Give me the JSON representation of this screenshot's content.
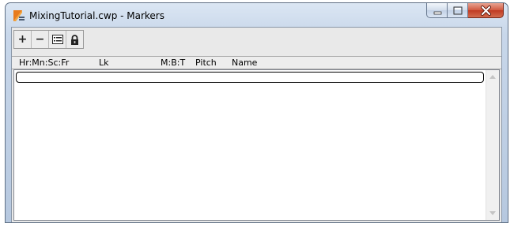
{
  "window": {
    "title": "MixingTutorial.cwp - Markers"
  },
  "toolbar": {
    "buttons": [
      {
        "label": "+",
        "icon": "plus-icon"
      },
      {
        "label": "−",
        "icon": "minus-icon"
      },
      {
        "label": "",
        "icon": "properties-icon"
      },
      {
        "label": "",
        "icon": "lock-icon"
      }
    ]
  },
  "columns": {
    "time": "Hr:Mn:Sc:Fr",
    "lock": "Lk",
    "mbt": "M:B:T",
    "pitch": "Pitch",
    "name": "Name"
  },
  "markers": [],
  "colors": {
    "title_bar": "#c8d7ea",
    "close_button": "#c03a22",
    "client_bg": "#e9e9e9",
    "list_bg": "#ffffff"
  }
}
